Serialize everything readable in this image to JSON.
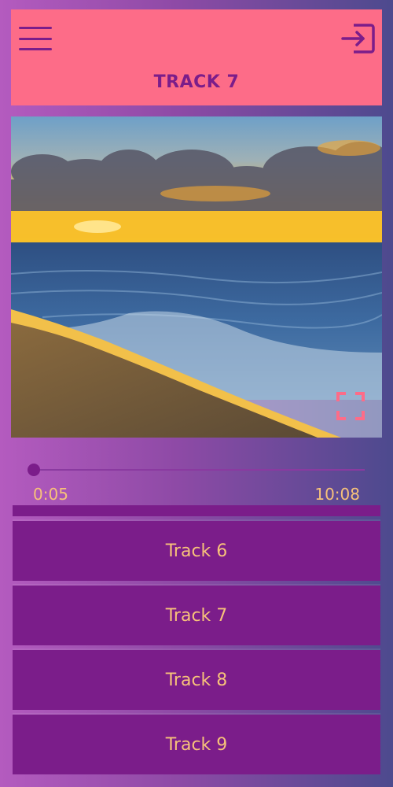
{
  "header": {
    "title": "TRACK 7",
    "menu_icon": "hamburger-menu-icon",
    "exit_icon": "sign-in-arrow-icon",
    "background": "#fd6c88",
    "accent": "#7b1d8a"
  },
  "player": {
    "current_time": "0:05",
    "duration": "10:08",
    "progress": 0.0082,
    "fullscreen_icon": "fullscreen-icon"
  },
  "playlist": {
    "tracks": [
      {
        "label": "Track 6"
      },
      {
        "label": "Track 7"
      },
      {
        "label": "Track 8"
      },
      {
        "label": "Track 9"
      }
    ]
  },
  "colors": {
    "track_bg": "#7b1d8a",
    "track_text": "#f7c27a",
    "time_text": "#f7c27a"
  }
}
